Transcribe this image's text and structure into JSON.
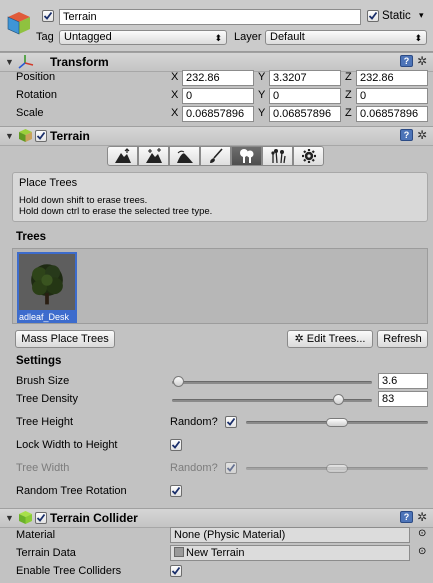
{
  "object": {
    "name": "Terrain",
    "active": true,
    "static_label": "Static",
    "static": true,
    "tag_label": "Tag",
    "tag_value": "Untagged",
    "layer_label": "Layer",
    "layer_value": "Default"
  },
  "transform": {
    "title": "Transform",
    "rows": [
      {
        "label": "Position",
        "x": "232.86",
        "y": "3.3207",
        "z": "232.86"
      },
      {
        "label": "Rotation",
        "x": "0",
        "y": "0",
        "z": "0"
      },
      {
        "label": "Scale",
        "x": "0.06857896",
        "y": "0.06857896",
        "z": "0.06857896"
      }
    ],
    "axis": {
      "x": "X",
      "y": "Y",
      "z": "Z"
    }
  },
  "terrain": {
    "title": "Terrain",
    "enabled": true,
    "tools": [
      {
        "icon": "raise-lower-terrain-icon"
      },
      {
        "icon": "paint-height-icon"
      },
      {
        "icon": "smooth-height-icon"
      },
      {
        "icon": "paint-texture-icon"
      },
      {
        "icon": "place-trees-icon",
        "active": true
      },
      {
        "icon": "paint-details-icon"
      },
      {
        "icon": "terrain-settings-icon"
      }
    ],
    "help": {
      "title": "Place Trees",
      "line1": "Hold down shift to erase trees.",
      "line2": "Hold down ctrl to erase the selected tree type."
    },
    "trees_label": "Trees",
    "tree_item": "adleaf_Desk",
    "buttons": {
      "mass_place": "Mass Place Trees",
      "edit_trees": "Edit Trees...",
      "refresh": "Refresh"
    },
    "settings_label": "Settings",
    "brush_size": {
      "label": "Brush Size",
      "value": "3.6",
      "fraction": 0.03
    },
    "tree_density": {
      "label": "Tree Density",
      "value": "83",
      "fraction": 0.83
    },
    "tree_height": {
      "label": "Tree Height",
      "random_label": "Random?",
      "random": true,
      "range": [
        0.44,
        0.56
      ]
    },
    "lock_width": {
      "label": "Lock Width to Height",
      "checked": true
    },
    "tree_width": {
      "label": "Tree Width",
      "random_label": "Random?",
      "random": true,
      "range": [
        0.44,
        0.56
      ]
    },
    "random_rotation": {
      "label": "Random Tree Rotation",
      "checked": true
    }
  },
  "collider": {
    "title": "Terrain Collider",
    "enabled": true,
    "material_label": "Material",
    "material_value": "None (Physic Material)",
    "data_label": "Terrain Data",
    "data_value": "New Terrain",
    "colliders_label": "Enable Tree Colliders",
    "colliders": true
  },
  "colors": {
    "background": "#c2c2c2",
    "selection": "#3d6ccd",
    "active_tool": "#5a5a5a"
  }
}
